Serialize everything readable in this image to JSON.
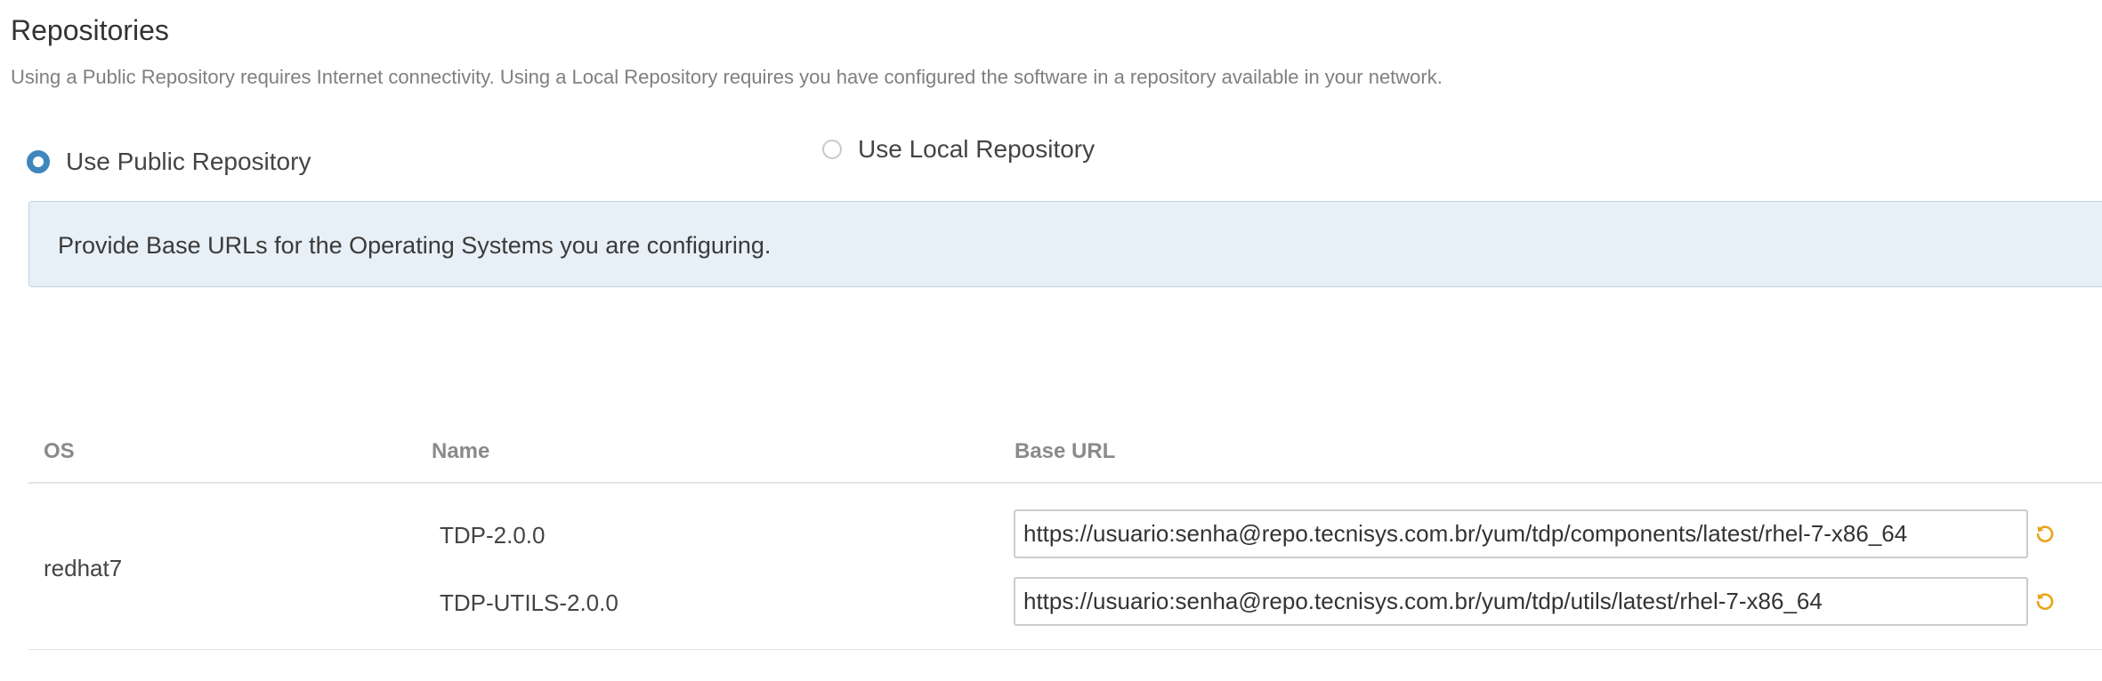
{
  "page": {
    "title": "Repositories",
    "description": "Using a Public Repository requires Internet connectivity. Using a Local Repository requires you have configured the software in a repository available in your network."
  },
  "repository_type": {
    "selected": "public",
    "options": [
      {
        "id": "public",
        "label": "Use Public Repository",
        "checked": true
      },
      {
        "id": "local",
        "label": "Use Local Repository",
        "checked": false
      }
    ]
  },
  "info_box": {
    "text": "Provide Base URLs for the Operating Systems you are configuring."
  },
  "table": {
    "headers": {
      "os": "OS",
      "name": "Name",
      "base_url": "Base URL"
    },
    "rows": [
      {
        "os": "redhat7",
        "repos": [
          {
            "name": "TDP-2.0.0",
            "base_url": "https://usuario:senha@repo.tecnisys.com.br/yum/tdp/components/latest/rhel-7-x86_64",
            "action_icon": "undo-icon"
          },
          {
            "name": "TDP-UTILS-2.0.0",
            "base_url": "https://usuario:senha@repo.tecnisys.com.br/yum/tdp/utils/latest/rhel-7-x86_64",
            "action_icon": "undo-icon"
          }
        ]
      }
    ]
  },
  "colors": {
    "radio_accent": "#3f86bd",
    "info_background": "#e7f0f6",
    "undo_icon": "#e8a317"
  }
}
